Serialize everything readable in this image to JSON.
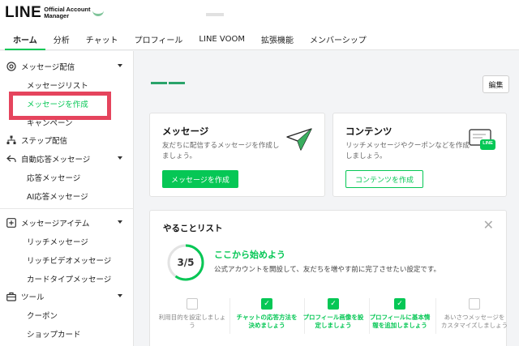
{
  "header": {
    "logo_big": "LINE",
    "logo_small": "Official Account Manager"
  },
  "nav": {
    "tabs": [
      {
        "label": "ホーム",
        "active": true
      },
      {
        "label": "分析",
        "active": false
      },
      {
        "label": "チャット",
        "active": false
      },
      {
        "label": "プロフィール",
        "active": false
      },
      {
        "label": "LINE VOOM",
        "active": false
      },
      {
        "label": "拡張機能",
        "active": false
      },
      {
        "label": "メンバーシップ",
        "active": false
      }
    ]
  },
  "sidebar": {
    "message_section": {
      "label": "メッセージ配信",
      "icon": "broadcast-icon"
    },
    "message_list": "メッセージリスト",
    "create_message": "メッセージを作成",
    "campaign": "キャンペーン",
    "step_delivery": {
      "label": "ステップ配信",
      "icon": "step-tree-icon"
    },
    "auto_reply": {
      "label": "自動応答メッセージ",
      "icon": "reply-arrow-icon"
    },
    "reply_message": "応答メッセージ",
    "ai_reply": "AI応答メッセージ",
    "message_items": {
      "label": "メッセージアイテム",
      "icon": "plus-square-icon"
    },
    "rich_message": "リッチメッセージ",
    "rich_video": "リッチビデオメッセージ",
    "card_type": "カードタイプメッセージ",
    "tools": {
      "label": "ツール",
      "icon": "toolbox-icon"
    },
    "coupon": "クーポン",
    "shop_card": "ショップカード"
  },
  "main": {
    "edit_button": "編集",
    "message_card": {
      "title": "メッセージ",
      "desc_line1": "友だちに配信するメッセージを作成し",
      "desc_line2": "ましょう。",
      "button": "メッセージを作成",
      "icon": "paper-plane-icon"
    },
    "content_card": {
      "title": "コンテンツ",
      "desc_line1": "リッチメッセージやクーポンなどを作成",
      "desc_line2": "しましょう。",
      "button": "コンテンツを作成",
      "icon": "line-chat-icon",
      "icon_badge": "LINE"
    },
    "todo": {
      "title": "やることリスト",
      "progress_text": "3/5",
      "progress_fraction": 0.6,
      "heading": "ここから始めよう",
      "subtext": "公式アカウントを開設して、友だちを増やす前に完了させたい設定です。",
      "steps": [
        {
          "line1": "利用目的を設定しましょ",
          "line2": "う",
          "done": false
        },
        {
          "line1": "チャットの応答方法を",
          "line2": "決めましょう",
          "done": true
        },
        {
          "line1": "プロフィール画像を設",
          "line2": "定しましょう",
          "done": true
        },
        {
          "line1": "プロフィールに基本情",
          "line2": "報を追加しましょう",
          "done": true
        },
        {
          "line1": "あいさつメッセージを",
          "line2": "カスタマイズしましょう",
          "done": false
        }
      ]
    }
  },
  "colors": {
    "accent": "#06c755",
    "highlight": "#e5445d"
  }
}
